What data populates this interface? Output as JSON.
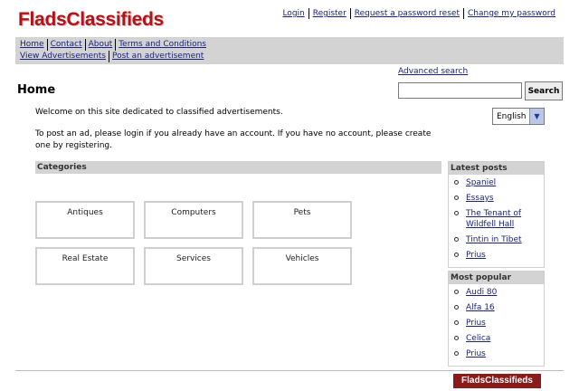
{
  "logo": "FladsClassifieds",
  "top_links": [
    "Login",
    "Register",
    "Request a password reset",
    "Change my password"
  ],
  "nav": {
    "row1": [
      "Home",
      "Contact",
      "About",
      "Terms and Conditions"
    ],
    "row2": [
      "View Advertisements",
      "Post an advertisement"
    ]
  },
  "search": {
    "advanced_label": "Advanced search",
    "button_label": "Search",
    "value": ""
  },
  "page_title": "Home",
  "language": {
    "selected": "English"
  },
  "welcome_text": "Welcome on this site dedicated to classified advertisements.",
  "post_ad_text": "To post an ad, please login if you already have an account. If you have no account, please create one by registering.",
  "categories": {
    "header": "Categories",
    "items": [
      "Antiques",
      "Computers",
      "Pets",
      "Real Estate",
      "Services",
      "Vehicles"
    ]
  },
  "latest_posts": {
    "header": "Latest posts",
    "items": [
      "Spaniel",
      "Essays",
      "The Tenant of Wildfell Hall",
      "Tintin in Tibet",
      "Prius"
    ]
  },
  "most_popular": {
    "header": "Most popular",
    "items": [
      "Audi 80",
      "Alfa 16",
      "Prius",
      "Celica",
      "Prius"
    ]
  },
  "footer_logo": "FladsClassifieds",
  "colors": {
    "brand": "#b0141a",
    "bar_grey": "#d3d3d3",
    "link": "#1a237e",
    "footer_bg": "#8b1a1a"
  },
  "icons": {
    "language_dropdown": "chevron-down-icon",
    "list_bullet": "circle-bullet-icon"
  }
}
